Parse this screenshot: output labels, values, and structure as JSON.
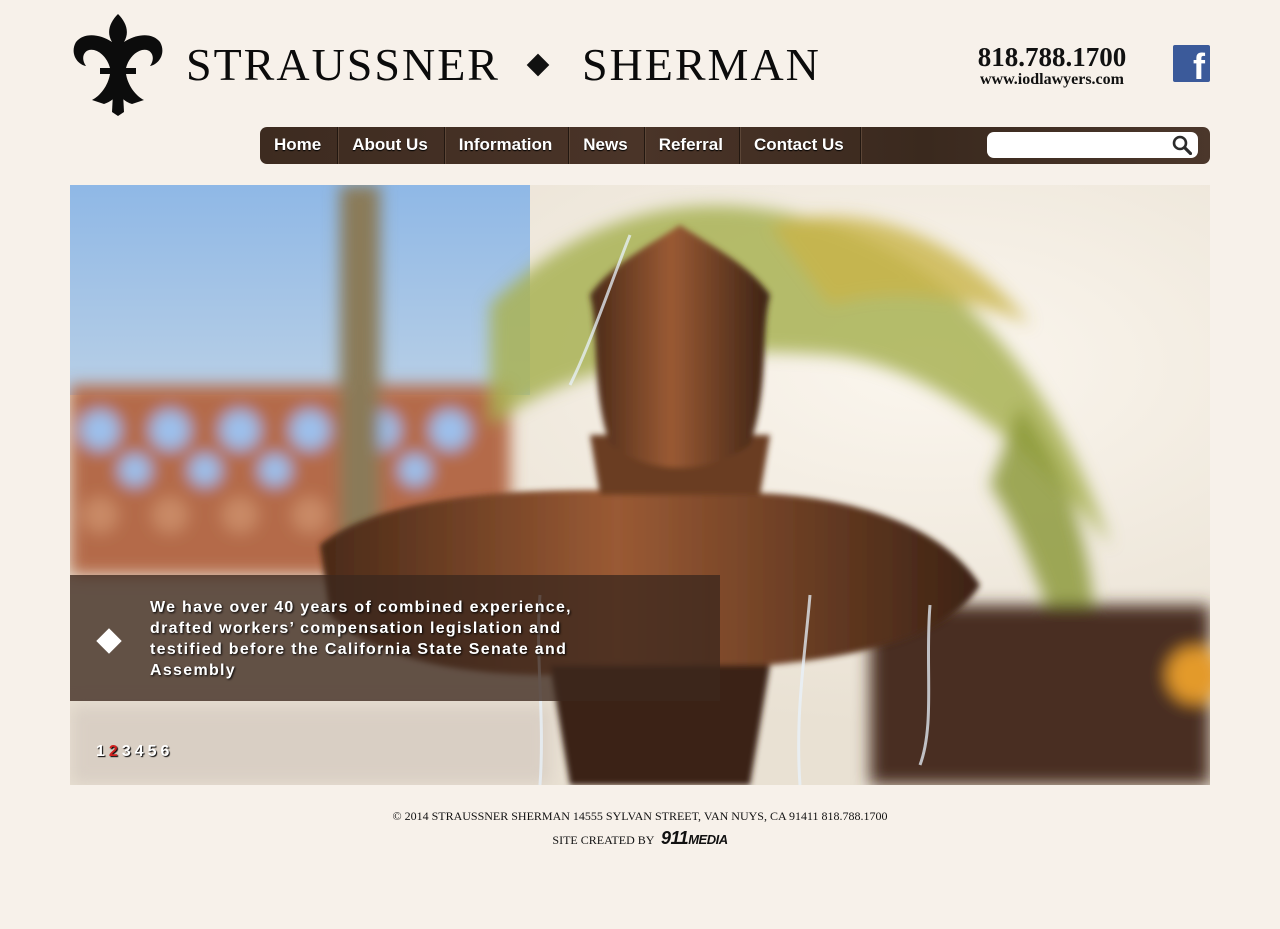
{
  "header": {
    "firm_name_left": "STRAUSSNER",
    "firm_name_right": "SHERMAN",
    "phone": "818.788.1700",
    "website": "www.iodlawyers.com",
    "social_icon": "facebook-icon",
    "social_letter": "f"
  },
  "nav": {
    "items": [
      {
        "label": "Home"
      },
      {
        "label": "About Us"
      },
      {
        "label": "Information"
      },
      {
        "label": "News"
      },
      {
        "label": "Referral"
      },
      {
        "label": "Contact Us"
      }
    ],
    "search_placeholder": "",
    "search_icon": "search-icon"
  },
  "hero": {
    "caption": "We have over 40 years of combined experience, drafted workers’ compensation legislation and testified before the California State Senate and Assembly",
    "slides": [
      "1",
      "2",
      "3",
      "4",
      "5",
      "6"
    ],
    "active_slide": "2",
    "active_color": "#d0201e"
  },
  "footer": {
    "copyright": "© 2014 STRAUSSNER SHERMAN 14555 SYLVAN STREET, VAN NUYS, CA 91411 818.788.1700",
    "credit_label": "SITE CREATED BY",
    "credit_brand_num": "911",
    "credit_brand_word": "MEDIA"
  },
  "colors": {
    "page_bg": "#f7f1ea",
    "nav_bg": "#3d2b20",
    "facebook": "#3b5a9a"
  }
}
